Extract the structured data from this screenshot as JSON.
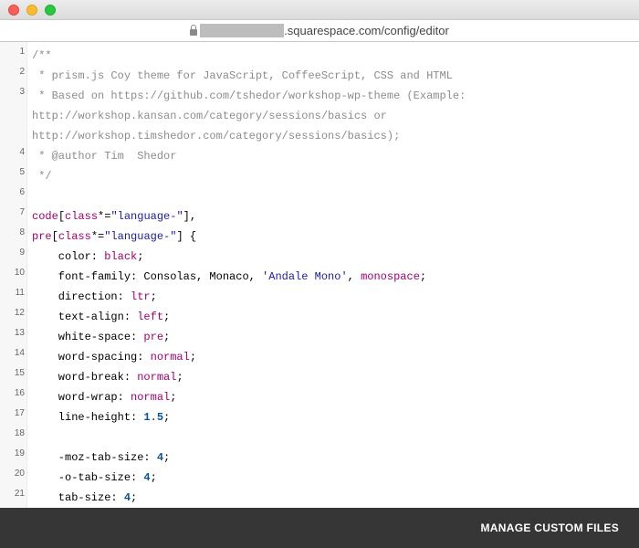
{
  "window": {
    "controls": [
      "close",
      "minimize",
      "maximize"
    ]
  },
  "address": {
    "domain_suffix": ".squarespace.com",
    "path": "/config/editor"
  },
  "editor": {
    "lines": [
      {
        "n": "1",
        "y": 0,
        "tokens": [
          {
            "t": "/**",
            "k": "comment"
          }
        ]
      },
      {
        "n": "2",
        "y": 1,
        "tokens": [
          {
            "t": " * prism.js Coy theme for JavaScript, CoffeeScript, CSS and HTML",
            "k": "comment"
          }
        ]
      },
      {
        "n": "3",
        "y": 2,
        "tokens": [
          {
            "t": " * Based on https://github.com/tshedor/workshop-wp-theme (Example:",
            "k": "comment"
          }
        ]
      },
      {
        "n": "",
        "y": 3,
        "tokens": [
          {
            "t": "http://workshop.kansan.com/category/sessions/basics or",
            "k": "comment"
          }
        ]
      },
      {
        "n": "",
        "y": 4,
        "tokens": [
          {
            "t": "http://workshop.timshedor.com/category/sessions/basics);",
            "k": "comment"
          }
        ]
      },
      {
        "n": "4",
        "y": 5,
        "tokens": [
          {
            "t": " * @author Tim  Shedor",
            "k": "comment"
          }
        ]
      },
      {
        "n": "5",
        "y": 6,
        "tokens": [
          {
            "t": " */",
            "k": "comment"
          }
        ]
      },
      {
        "n": "6",
        "y": 7,
        "tokens": []
      },
      {
        "n": "7",
        "y": 8,
        "tokens": [
          {
            "t": "code",
            "k": "sel"
          },
          {
            "t": "[",
            "k": "plain"
          },
          {
            "t": "class",
            "k": "attr"
          },
          {
            "t": "*=",
            "k": "plain"
          },
          {
            "t": "\"language-\"",
            "k": "str"
          },
          {
            "t": "],",
            "k": "plain"
          }
        ]
      },
      {
        "n": "8",
        "y": 9,
        "tokens": [
          {
            "t": "pre",
            "k": "sel"
          },
          {
            "t": "[",
            "k": "plain"
          },
          {
            "t": "class",
            "k": "attr"
          },
          {
            "t": "*=",
            "k": "plain"
          },
          {
            "t": "\"language-\"",
            "k": "str"
          },
          {
            "t": "] {",
            "k": "plain"
          }
        ]
      },
      {
        "n": "9",
        "y": 10,
        "tokens": [
          {
            "t": "    color: ",
            "k": "plain"
          },
          {
            "t": "black",
            "k": "val"
          },
          {
            "t": ";",
            "k": "plain"
          }
        ]
      },
      {
        "n": "10",
        "y": 11,
        "tokens": [
          {
            "t": "    font-family: Consolas, Monaco, ",
            "k": "plain"
          },
          {
            "t": "'Andale Mono'",
            "k": "str"
          },
          {
            "t": ", ",
            "k": "plain"
          },
          {
            "t": "monospace",
            "k": "val"
          },
          {
            "t": ";",
            "k": "plain"
          }
        ]
      },
      {
        "n": "11",
        "y": 12,
        "tokens": [
          {
            "t": "    direction: ",
            "k": "plain"
          },
          {
            "t": "ltr",
            "k": "val"
          },
          {
            "t": ";",
            "k": "plain"
          }
        ]
      },
      {
        "n": "12",
        "y": 13,
        "tokens": [
          {
            "t": "    text-align: ",
            "k": "plain"
          },
          {
            "t": "left",
            "k": "val"
          },
          {
            "t": ";",
            "k": "plain"
          }
        ]
      },
      {
        "n": "13",
        "y": 14,
        "tokens": [
          {
            "t": "    white-space: ",
            "k": "plain"
          },
          {
            "t": "pre",
            "k": "val"
          },
          {
            "t": ";",
            "k": "plain"
          }
        ]
      },
      {
        "n": "14",
        "y": 15,
        "tokens": [
          {
            "t": "    word-spacing: ",
            "k": "plain"
          },
          {
            "t": "normal",
            "k": "val"
          },
          {
            "t": ";",
            "k": "plain"
          }
        ]
      },
      {
        "n": "15",
        "y": 16,
        "tokens": [
          {
            "t": "    word-break: ",
            "k": "plain"
          },
          {
            "t": "normal",
            "k": "val"
          },
          {
            "t": ";",
            "k": "plain"
          }
        ]
      },
      {
        "n": "16",
        "y": 17,
        "tokens": [
          {
            "t": "    word-wrap: ",
            "k": "plain"
          },
          {
            "t": "normal",
            "k": "val"
          },
          {
            "t": ";",
            "k": "plain"
          }
        ]
      },
      {
        "n": "17",
        "y": 18,
        "tokens": [
          {
            "t": "    line-height: ",
            "k": "plain"
          },
          {
            "t": "1.5",
            "k": "num"
          },
          {
            "t": ";",
            "k": "plain"
          }
        ]
      },
      {
        "n": "18",
        "y": 19,
        "tokens": []
      },
      {
        "n": "19",
        "y": 20,
        "tokens": [
          {
            "t": "    -moz-tab-size: ",
            "k": "plain"
          },
          {
            "t": "4",
            "k": "num"
          },
          {
            "t": ";",
            "k": "plain"
          }
        ]
      },
      {
        "n": "20",
        "y": 21,
        "tokens": [
          {
            "t": "    -o-tab-size: ",
            "k": "plain"
          },
          {
            "t": "4",
            "k": "num"
          },
          {
            "t": ";",
            "k": "plain"
          }
        ]
      },
      {
        "n": "21",
        "y": 22,
        "tokens": [
          {
            "t": "    tab-size: ",
            "k": "plain"
          },
          {
            "t": "4",
            "k": "num"
          },
          {
            "t": ";",
            "k": "plain"
          }
        ]
      },
      {
        "n": "",
        "y": 23,
        "tokens": []
      }
    ]
  },
  "footer": {
    "manage_label": "MANAGE CUSTOM FILES"
  },
  "colors": {
    "footer_bg": "#363636",
    "selector": "#a0006e",
    "string": "#1a1aa6",
    "number": "#0b5394",
    "comment": "#8c8c8c"
  }
}
